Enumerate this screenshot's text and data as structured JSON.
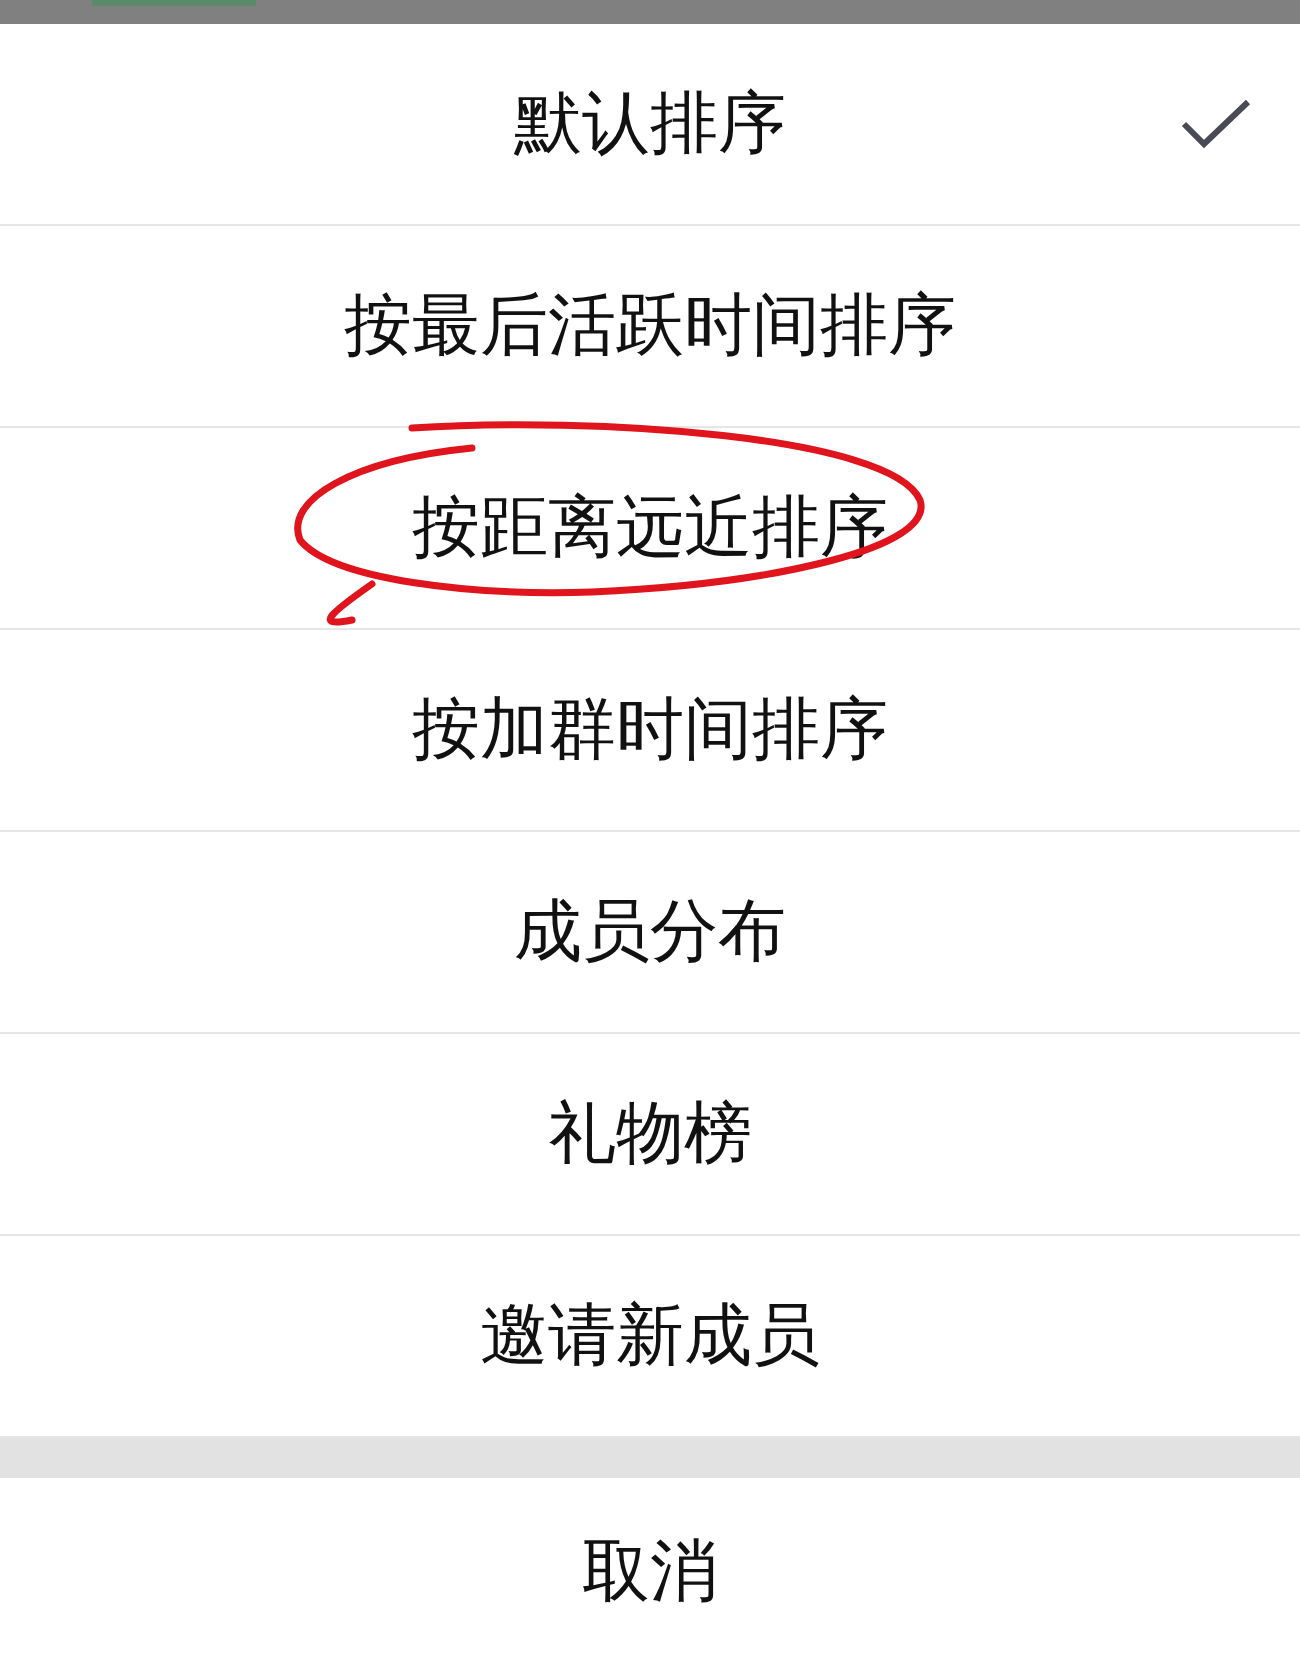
{
  "menu": {
    "items": [
      {
        "label": "默认排序",
        "selected": true,
        "annotated": false
      },
      {
        "label": "按最后活跃时间排序",
        "selected": false,
        "annotated": false
      },
      {
        "label": "按距离远近排序",
        "selected": false,
        "annotated": true
      },
      {
        "label": "按加群时间排序",
        "selected": false,
        "annotated": false
      },
      {
        "label": "成员分布",
        "selected": false,
        "annotated": false
      },
      {
        "label": "礼物榜",
        "selected": false,
        "annotated": false
      },
      {
        "label": "邀请新成员",
        "selected": false,
        "annotated": false
      }
    ]
  },
  "cancel": "取消"
}
